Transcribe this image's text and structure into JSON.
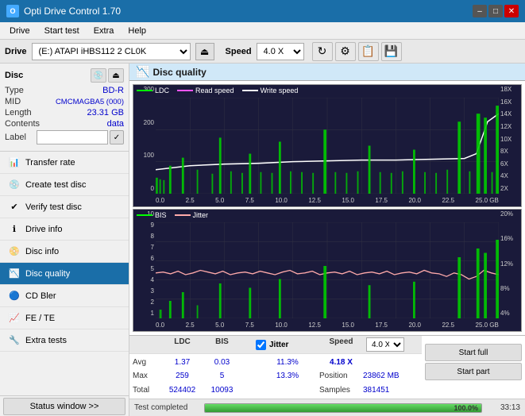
{
  "titleBar": {
    "title": "Opti Drive Control 1.70",
    "minimizeBtn": "–",
    "maximizeBtn": "□",
    "closeBtn": "✕"
  },
  "menuBar": {
    "items": [
      "Drive",
      "Start test",
      "Extra",
      "Help"
    ]
  },
  "driveBar": {
    "label": "Drive",
    "driveValue": "(E:)  ATAPI iHBS112  2 CL0K",
    "speedLabel": "Speed",
    "speedValue": "4.0 X"
  },
  "disc": {
    "label": "Disc",
    "type_label": "Type",
    "type_value": "BD-R",
    "mid_label": "MID",
    "mid_value": "CMCMAGBA5 (000)",
    "length_label": "Length",
    "length_value": "23.31 GB",
    "contents_label": "Contents",
    "contents_value": "data",
    "label_label": "Label",
    "label_value": ""
  },
  "sidebar": {
    "items": [
      {
        "id": "transfer-rate",
        "label": "Transfer rate",
        "icon": "📊"
      },
      {
        "id": "create-test-disc",
        "label": "Create test disc",
        "icon": "💿"
      },
      {
        "id": "verify-test-disc",
        "label": "Verify test disc",
        "icon": "✔"
      },
      {
        "id": "drive-info",
        "label": "Drive info",
        "icon": "ℹ"
      },
      {
        "id": "disc-info",
        "label": "Disc info",
        "icon": "📀"
      },
      {
        "id": "disc-quality",
        "label": "Disc quality",
        "icon": "📉",
        "active": true
      },
      {
        "id": "cd-bler",
        "label": "CD Bler",
        "icon": "🔵"
      },
      {
        "id": "fe-te",
        "label": "FE / TE",
        "icon": "📈"
      },
      {
        "id": "extra-tests",
        "label": "Extra tests",
        "icon": "🔧"
      }
    ]
  },
  "contentHeader": {
    "title": "Disc quality"
  },
  "chart1": {
    "legend": [
      {
        "label": "LDC",
        "color": "#00ff00"
      },
      {
        "label": "Read speed",
        "color": "#ff00ff"
      },
      {
        "label": "Write speed",
        "color": "#ffffff"
      }
    ],
    "yAxisLeft": [
      "300",
      "200",
      "100",
      "0"
    ],
    "yAxisRight": [
      "18X",
      "16X",
      "14X",
      "12X",
      "10X",
      "8X",
      "6X",
      "4X",
      "2X"
    ],
    "xAxis": [
      "0.0",
      "2.5",
      "5.0",
      "7.5",
      "10.0",
      "12.5",
      "15.0",
      "17.5",
      "20.0",
      "22.5",
      "25.0 GB"
    ]
  },
  "chart2": {
    "legend": [
      {
        "label": "BIS",
        "color": "#00ff00"
      },
      {
        "label": "Jitter",
        "color": "#ff9999"
      }
    ],
    "yAxisLeft": [
      "10",
      "9",
      "8",
      "7",
      "6",
      "5",
      "4",
      "3",
      "2",
      "1"
    ],
    "yAxisRight": [
      "20%",
      "16%",
      "12%",
      "8%",
      "4%"
    ],
    "xAxis": [
      "0.0",
      "2.5",
      "5.0",
      "7.5",
      "10.0",
      "12.5",
      "15.0",
      "17.5",
      "20.0",
      "22.5",
      "25.0 GB"
    ]
  },
  "statsHeaders": {
    "ldc": "LDC",
    "bis": "BIS",
    "jitter": "Jitter",
    "speed": "Speed",
    "position": "Position"
  },
  "statsData": {
    "avg": {
      "label": "Avg",
      "ldc": "1.37",
      "bis": "0.03",
      "jitter": "11.3%",
      "speed_val": "4.18 X",
      "speed_select": "4.0 X"
    },
    "max": {
      "label": "Max",
      "ldc": "259",
      "bis": "5",
      "jitter": "13.3%",
      "position_label": "Position",
      "position_val": "23862 MB"
    },
    "total": {
      "label": "Total",
      "ldc": "524402",
      "bis": "10093",
      "samples_label": "Samples",
      "samples_val": "381451"
    }
  },
  "buttons": {
    "statusWindow": "Status window >>",
    "startFull": "Start full",
    "startPart": "Start part"
  },
  "progressBar": {
    "label": "Test completed",
    "percent": 100,
    "percentText": "100.0%",
    "timeText": "33:13"
  }
}
